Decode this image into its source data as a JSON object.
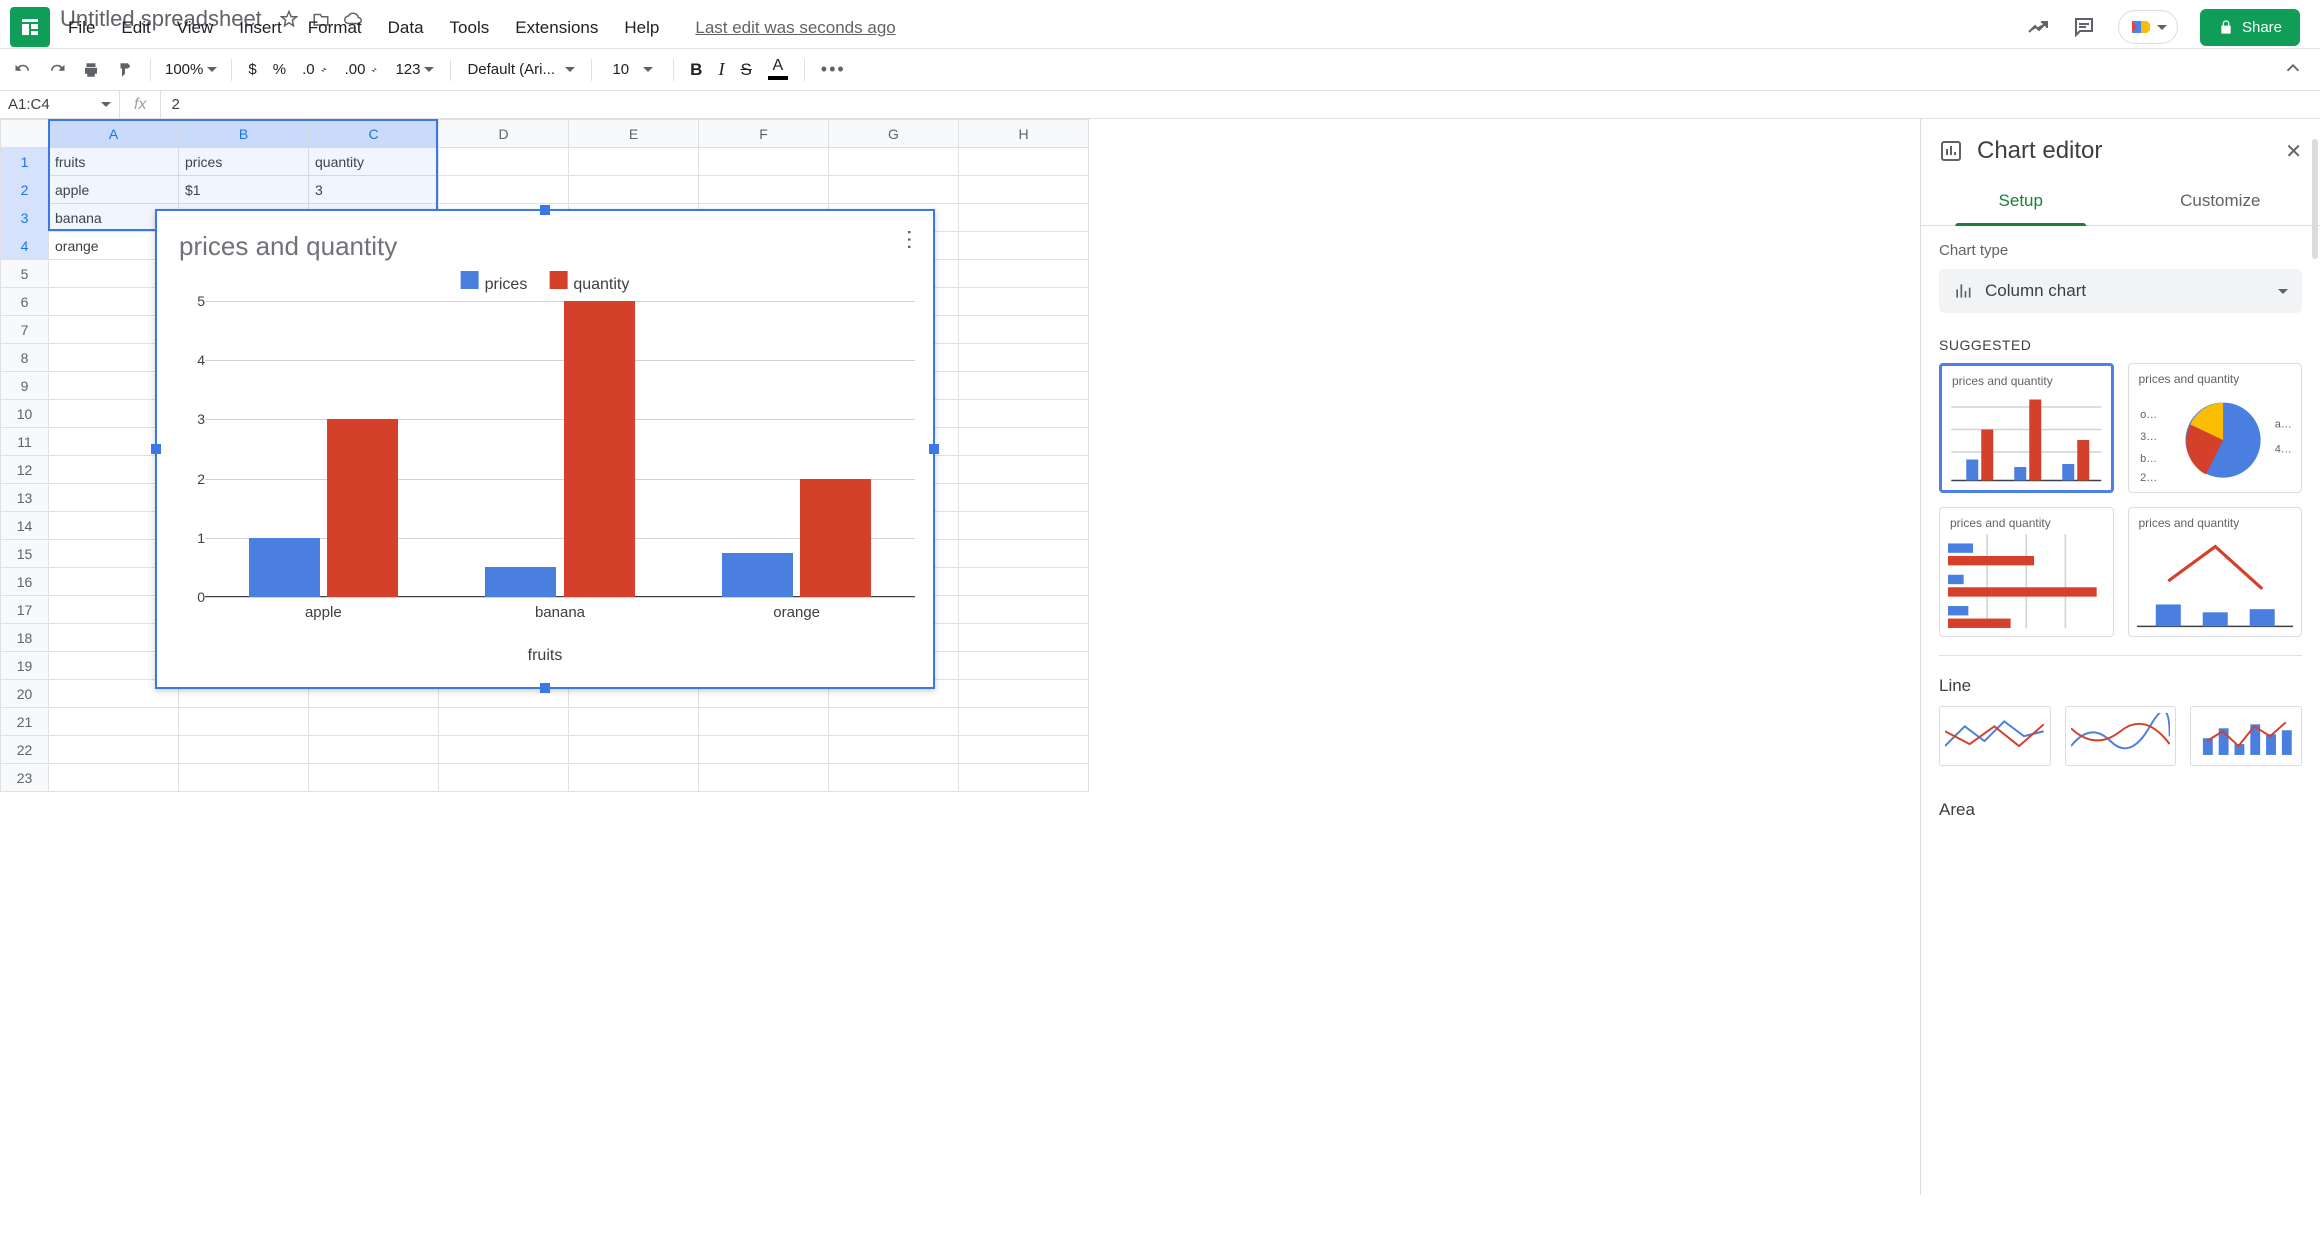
{
  "doc_title": "Untitled spreadsheet",
  "menus": [
    "File",
    "Edit",
    "View",
    "Insert",
    "Format",
    "Data",
    "Tools",
    "Extensions",
    "Help"
  ],
  "last_edit": "Last edit was seconds ago",
  "share": "Share",
  "toolbar": {
    "zoom": "100%",
    "dollar": "$",
    "percent": "%",
    "dec_dec": ".0",
    "dec_inc": ".00",
    "num_fmt": "123",
    "font": "Default (Ari...",
    "size": "10"
  },
  "name_box": "A1:C4",
  "fx_value": "2",
  "columns": [
    "A",
    "B",
    "C",
    "D",
    "E",
    "F",
    "G",
    "H"
  ],
  "row_count": 23,
  "cells": {
    "r1": {
      "A": "fruits",
      "B": "prices",
      "C": "quantity"
    },
    "r2": {
      "A": "apple",
      "B": "$1",
      "C": "3"
    },
    "r3": {
      "A": "banana"
    },
    "r4": {
      "A": "orange"
    }
  },
  "editor": {
    "title": "Chart editor",
    "tab_setup": "Setup",
    "tab_customize": "Customize",
    "chart_type_label": "Chart type",
    "chart_type_value": "Column chart",
    "suggested": "SUGGESTED",
    "line": "Line",
    "area": "Area",
    "thumb_title": "prices and quantity",
    "pie_labels": [
      "o…",
      "a…",
      "4…",
      "3…",
      "b…",
      "2…"
    ]
  },
  "chart_data": {
    "type": "bar",
    "title": "prices and quantity",
    "xlabel": "fruits",
    "ylabel": "",
    "ylim": [
      0,
      5
    ],
    "yticks": [
      0,
      1,
      2,
      3,
      4,
      5
    ],
    "categories": [
      "apple",
      "banana",
      "orange"
    ],
    "series": [
      {
        "name": "prices",
        "color": "#4a7fe0",
        "values": [
          1,
          0.5,
          0.75
        ]
      },
      {
        "name": "quantity",
        "color": "#d5402a",
        "values": [
          3,
          5,
          2
        ]
      }
    ]
  }
}
